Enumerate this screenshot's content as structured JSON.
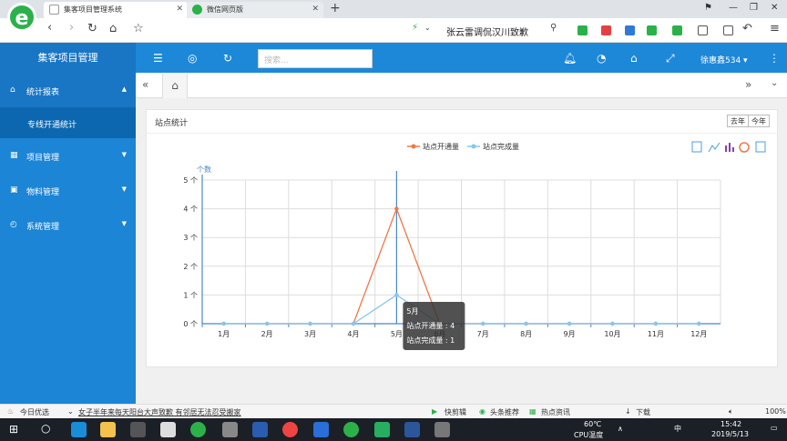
{
  "browser": {
    "active_tab": "集客项目管理系统",
    "other_tab": "微信网页版",
    "address_text": "张云雷调侃汉川致歉"
  },
  "app": {
    "brand": "集客项目管理",
    "search_placeholder": "搜索...",
    "user": "徐惠鑫534 ▾",
    "brand_color": "#1e88d8"
  },
  "sidebar": {
    "items": [
      {
        "label": "统计报表",
        "icon": "home-icon",
        "arrow": "▲"
      },
      {
        "label": "项目管理",
        "icon": "table-icon",
        "arrow": "▼"
      },
      {
        "label": "物料管理",
        "icon": "grid-icon",
        "arrow": "▼"
      },
      {
        "label": "系统管理",
        "icon": "gauge-icon",
        "arrow": "▼"
      }
    ],
    "subitem": "专线开通统计"
  },
  "panel": {
    "title": "站点统计",
    "btn_last_year": "去年",
    "btn_this_year": "今年"
  },
  "chart_data": {
    "type": "line",
    "ylabel": "个数",
    "categories": [
      "1月",
      "2月",
      "3月",
      "4月",
      "5月",
      "6月",
      "7月",
      "8月",
      "9月",
      "10月",
      "11月",
      "12月"
    ],
    "ytick_labels": [
      "0 个",
      "1 个",
      "2 个",
      "3 个",
      "4 个",
      "5 个"
    ],
    "ylim": [
      0,
      5
    ],
    "series": [
      {
        "name": "站点开通量",
        "color": "#f07845",
        "values": [
          0,
          0,
          0,
          0,
          4,
          0,
          0,
          0,
          0,
          0,
          0,
          0
        ]
      },
      {
        "name": "站点完成量",
        "color": "#86c6ef",
        "values": [
          0,
          0,
          0,
          0,
          1,
          0,
          0,
          0,
          0,
          0,
          0,
          0
        ]
      }
    ],
    "tooltip": {
      "title": "5月",
      "lines": [
        "站点开通量 : 4",
        "站点完成量 : 1"
      ]
    }
  },
  "news": {
    "today": "今日优选",
    "headline": "女子半年来每天阳台大声致歉 有邻居无法忍受搬家",
    "items": [
      "快剪辑",
      "头条推荐",
      "热点资讯",
      "下载"
    ],
    "zoom": "100%"
  },
  "taskbar": {
    "temp": "60℃",
    "temp_label": "CPU温度",
    "ime": "中",
    "time": "15:42",
    "date": "2019/5/13"
  }
}
